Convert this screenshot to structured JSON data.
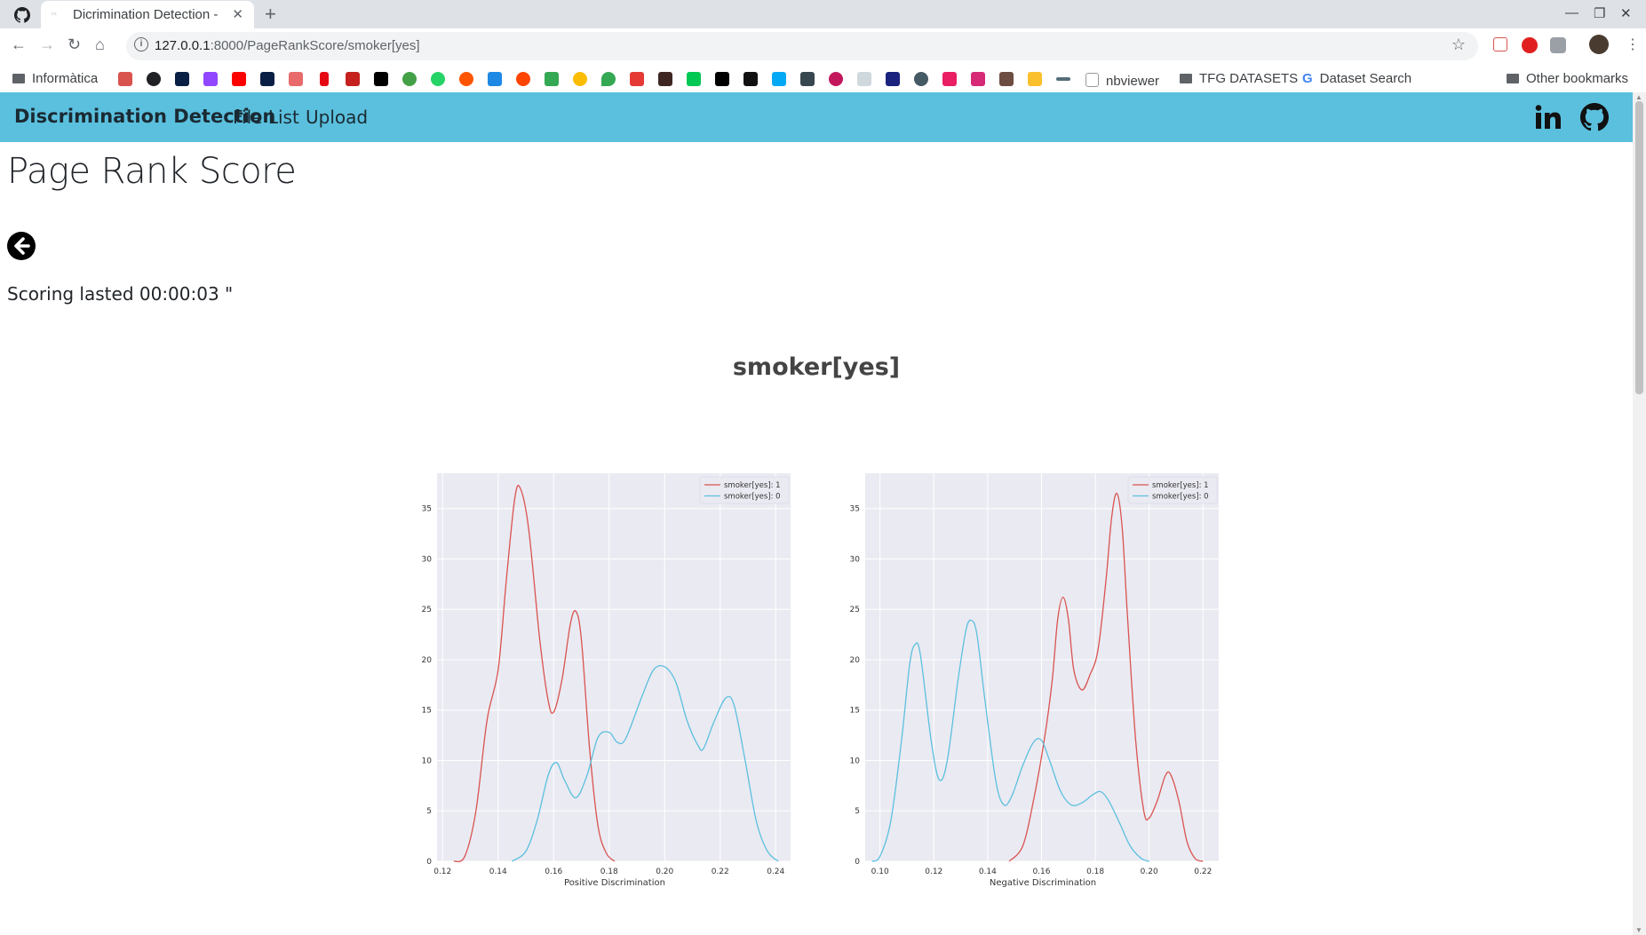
{
  "browser": {
    "tab_title": "Dicrimination Detection -",
    "url_host": "127.0.0.1",
    "url_path": ":8000/PageRankScore/smoker[yes]",
    "bookmarks": {
      "first_folder": "Informàtica",
      "nbviewer": "nbviewer",
      "tfg": "TFG DATASETS",
      "dataset_search": "Dataset Search",
      "other": "Other bookmarks"
    }
  },
  "navbar": {
    "brand": "Discrimination Detection",
    "links": [
      "File List",
      "Upload"
    ]
  },
  "page": {
    "title": "Page Rank Score",
    "timing": "Scoring lasted 00:00:03 \"",
    "attribute": "smoker[yes]"
  },
  "colors": {
    "navbar": "#5bc0de",
    "series_red": "#d9534f",
    "series_blue": "#5bc0de",
    "plot_bg": "#eaeaf2"
  },
  "chart_data": [
    {
      "type": "line",
      "xlabel": "Positive Discrimination",
      "ylabel": "",
      "xlim": [
        0.118,
        0.246
      ],
      "ylim": [
        0,
        38.5
      ],
      "xticks": [
        "0.12",
        "0.14",
        "0.16",
        "0.18",
        "0.20",
        "0.22",
        "0.24"
      ],
      "yticks": [
        "0",
        "5",
        "10",
        "15",
        "20",
        "25",
        "30",
        "35"
      ],
      "legend_position": "top-right",
      "grid": true,
      "series": [
        {
          "name": "smoker[yes]: 1",
          "color": "#d9534f",
          "points": [
            [
              0.124,
              0
            ],
            [
              0.128,
              0.5
            ],
            [
              0.132,
              5
            ],
            [
              0.136,
              14
            ],
            [
              0.14,
              19
            ],
            [
              0.143,
              28
            ],
            [
              0.146,
              36
            ],
            [
              0.148,
              37
            ],
            [
              0.151,
              33
            ],
            [
              0.155,
              22
            ],
            [
              0.158,
              16
            ],
            [
              0.16,
              14.8
            ],
            [
              0.163,
              18
            ],
            [
              0.166,
              23.5
            ],
            [
              0.168,
              24.8
            ],
            [
              0.17,
              22
            ],
            [
              0.173,
              11
            ],
            [
              0.176,
              3.5
            ],
            [
              0.179,
              0.8
            ],
            [
              0.182,
              0
            ]
          ]
        },
        {
          "name": "smoker[yes]: 0",
          "color": "#5bc0de",
          "points": [
            [
              0.145,
              0
            ],
            [
              0.15,
              1
            ],
            [
              0.154,
              4
            ],
            [
              0.158,
              8.5
            ],
            [
              0.161,
              9.8
            ],
            [
              0.164,
              8
            ],
            [
              0.168,
              6.3
            ],
            [
              0.172,
              8.5
            ],
            [
              0.176,
              12.3
            ],
            [
              0.18,
              12.8
            ],
            [
              0.183,
              11.8
            ],
            [
              0.186,
              12.2
            ],
            [
              0.192,
              16.5
            ],
            [
              0.196,
              19
            ],
            [
              0.2,
              19.3
            ],
            [
              0.204,
              17.8
            ],
            [
              0.208,
              14
            ],
            [
              0.212,
              11.5
            ],
            [
              0.214,
              11.2
            ],
            [
              0.218,
              14
            ],
            [
              0.222,
              16.2
            ],
            [
              0.225,
              15.5
            ],
            [
              0.229,
              10
            ],
            [
              0.233,
              4
            ],
            [
              0.237,
              1
            ],
            [
              0.241,
              0
            ]
          ]
        }
      ]
    },
    {
      "type": "line",
      "xlabel": "Negative Discrimination",
      "ylabel": "",
      "xlim": [
        0.0945,
        0.2265
      ],
      "ylim": [
        0,
        38.5
      ],
      "xticks": [
        "0.10",
        "0.12",
        "0.14",
        "0.16",
        "0.18",
        "0.20",
        "0.22"
      ],
      "yticks": [
        "0",
        "5",
        "10",
        "15",
        "20",
        "25",
        "30",
        "35"
      ],
      "legend_position": "top-right",
      "grid": true,
      "series": [
        {
          "name": "smoker[yes]: 1",
          "color": "#d9534f",
          "points": [
            [
              0.148,
              0
            ],
            [
              0.153,
              1.5
            ],
            [
              0.157,
              6
            ],
            [
              0.161,
              12
            ],
            [
              0.164,
              18
            ],
            [
              0.166,
              24
            ],
            [
              0.168,
              26.2
            ],
            [
              0.17,
              24
            ],
            [
              0.172,
              19
            ],
            [
              0.175,
              17
            ],
            [
              0.178,
              18.5
            ],
            [
              0.181,
              21
            ],
            [
              0.184,
              28
            ],
            [
              0.186,
              34
            ],
            [
              0.188,
              36.5
            ],
            [
              0.19,
              33
            ],
            [
              0.192,
              24
            ],
            [
              0.195,
              12
            ],
            [
              0.198,
              5
            ],
            [
              0.2,
              4.3
            ],
            [
              0.203,
              6
            ],
            [
              0.206,
              8.5
            ],
            [
              0.208,
              8.6
            ],
            [
              0.211,
              6
            ],
            [
              0.214,
              2
            ],
            [
              0.217,
              0.3
            ],
            [
              0.22,
              0
            ]
          ]
        },
        {
          "name": "smoker[yes]: 0",
          "color": "#5bc0de",
          "points": [
            [
              0.097,
              0
            ],
            [
              0.1,
              0.5
            ],
            [
              0.104,
              4
            ],
            [
              0.108,
              12
            ],
            [
              0.111,
              19.5
            ],
            [
              0.113,
              21.5
            ],
            [
              0.115,
              20.5
            ],
            [
              0.119,
              12
            ],
            [
              0.122,
              8.1
            ],
            [
              0.125,
              10
            ],
            [
              0.129,
              18
            ],
            [
              0.132,
              23
            ],
            [
              0.134,
              23.9
            ],
            [
              0.136,
              22.5
            ],
            [
              0.139,
              16
            ],
            [
              0.143,
              8
            ],
            [
              0.146,
              5.6
            ],
            [
              0.149,
              6.5
            ],
            [
              0.153,
              9.5
            ],
            [
              0.157,
              11.8
            ],
            [
              0.16,
              12
            ],
            [
              0.163,
              10
            ],
            [
              0.167,
              7
            ],
            [
              0.171,
              5.6
            ],
            [
              0.175,
              5.8
            ],
            [
              0.179,
              6.6
            ],
            [
              0.182,
              6.9
            ],
            [
              0.185,
              6
            ],
            [
              0.189,
              3.8
            ],
            [
              0.193,
              1.5
            ],
            [
              0.197,
              0.3
            ],
            [
              0.2,
              0
            ]
          ]
        }
      ]
    }
  ]
}
